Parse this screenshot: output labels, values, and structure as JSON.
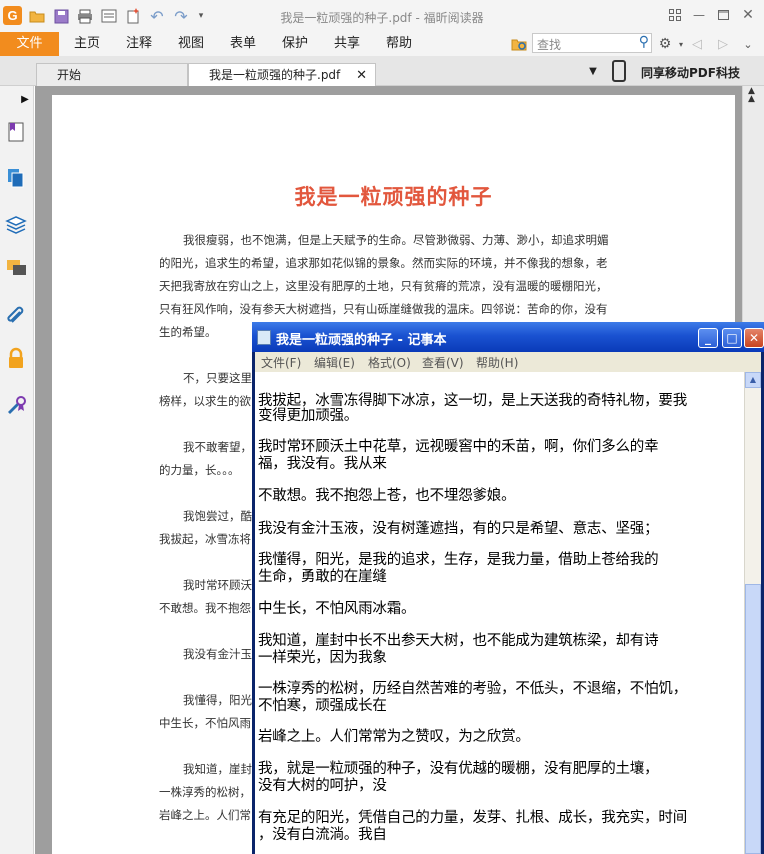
{
  "window": {
    "title": "我是一粒顽强的种子.pdf - 福昕阅读器"
  },
  "quick_access": [
    "app-logo",
    "open-icon",
    "save-icon",
    "print-icon",
    "properties-icon",
    "new-icon",
    "undo-icon",
    "redo-icon",
    "customize-icon"
  ],
  "ribbon": {
    "file_label": "文件",
    "menus": [
      "主页",
      "注释",
      "视图",
      "表单",
      "保护",
      "共享",
      "帮助"
    ],
    "search_placeholder": "查找"
  },
  "tabs": {
    "home_label": "开始",
    "doc_label": "我是一粒顽强的种子.pdf",
    "mobile_promo": "同享移动PDF科技"
  },
  "document": {
    "title": "我是一粒顽强的种子",
    "visible_lines": [
      "我很瘦弱，也不饱满，但是上天赋予的生命。尽管渺微弱、力薄、渺小，却追求明媚",
      "的阳光，追求生的希望，追求那如花似锦的景象。然而实际的环境，并不像我的想象，老",
      "天把我寄放在穷山之上，这里没有肥厚的土地，只有贫瘠的荒凉，没有温暖的暖棚阳光，",
      "只有狂风作响，没有参天大树遮挡，只有山砾崖缝做我的温床。四邻说：苦命的你，没有",
      "生的希望。",
      "不，只要这里",
      "榜样，以求生的欲",
      "我不敢奢望，",
      "的力量，长。。。",
      "我饱尝过，酷",
      "我拔起，冰雪冻将",
      "我时常环顾沃",
      "不敢想。我不抱怨",
      "我没有金汁玉",
      "我懂得，阳光",
      "中生长，不怕风雨",
      "我知道，崖封",
      "一株淳秀的松树，",
      "岩峰之上。人们常"
    ]
  },
  "notepad": {
    "title": "我是一粒顽强的种子 - 记事本",
    "menu": [
      "文件(F)",
      "编辑(E)",
      "格式(O)",
      "查看(V)",
      "帮助(H)"
    ],
    "lines": [
      "我拔起，冰雪冻得脚下冰凉，这一切，是上天送我的奇特礼物，要我",
      "变得更加顽强。",
      "    我时常环顾沃土中花草，远视暖窖中的禾苗，啊，你们多么的幸",
      "福，我没有。我从来",
      "不敢想。我不抱怨上苍，也不埋怨爹娘。",
      "    我没有金汁玉液，没有树蓬遮挡，有的只是希望、意志、坚强；",
      "    我懂得，阳光，是我的追求，生存，是我力量，借助上苍给我的",
      "生命，勇敢的在崖缝",
      "中生长，不怕风雨冰霜。",
      "    我知道，崖封中长不出参天大树，也不能成为建筑栋梁，却有诗",
      "一样荣光，因为我象",
      "一株淳秀的松树，历经自然苦难的考验，不低头，不退缩，不怕饥，",
      "不怕寒，顽强成长在",
      "岩峰之上。人们常常为之赞叹，为之欣赏。",
      "    我，就是一粒顽强的种子，没有优越的暖棚，没有肥厚的土壤，",
      "没有大树的呵护，没",
      "有充足的阳光，凭借自己的力量，发芽、扎根、成长，我充实，时间",
      "，没有白流淌。我自"
    ]
  },
  "colors": {
    "accent": "#f28c1e",
    "doc_title": "#e2573d",
    "notepad_titlebar": "#1a52d1"
  }
}
